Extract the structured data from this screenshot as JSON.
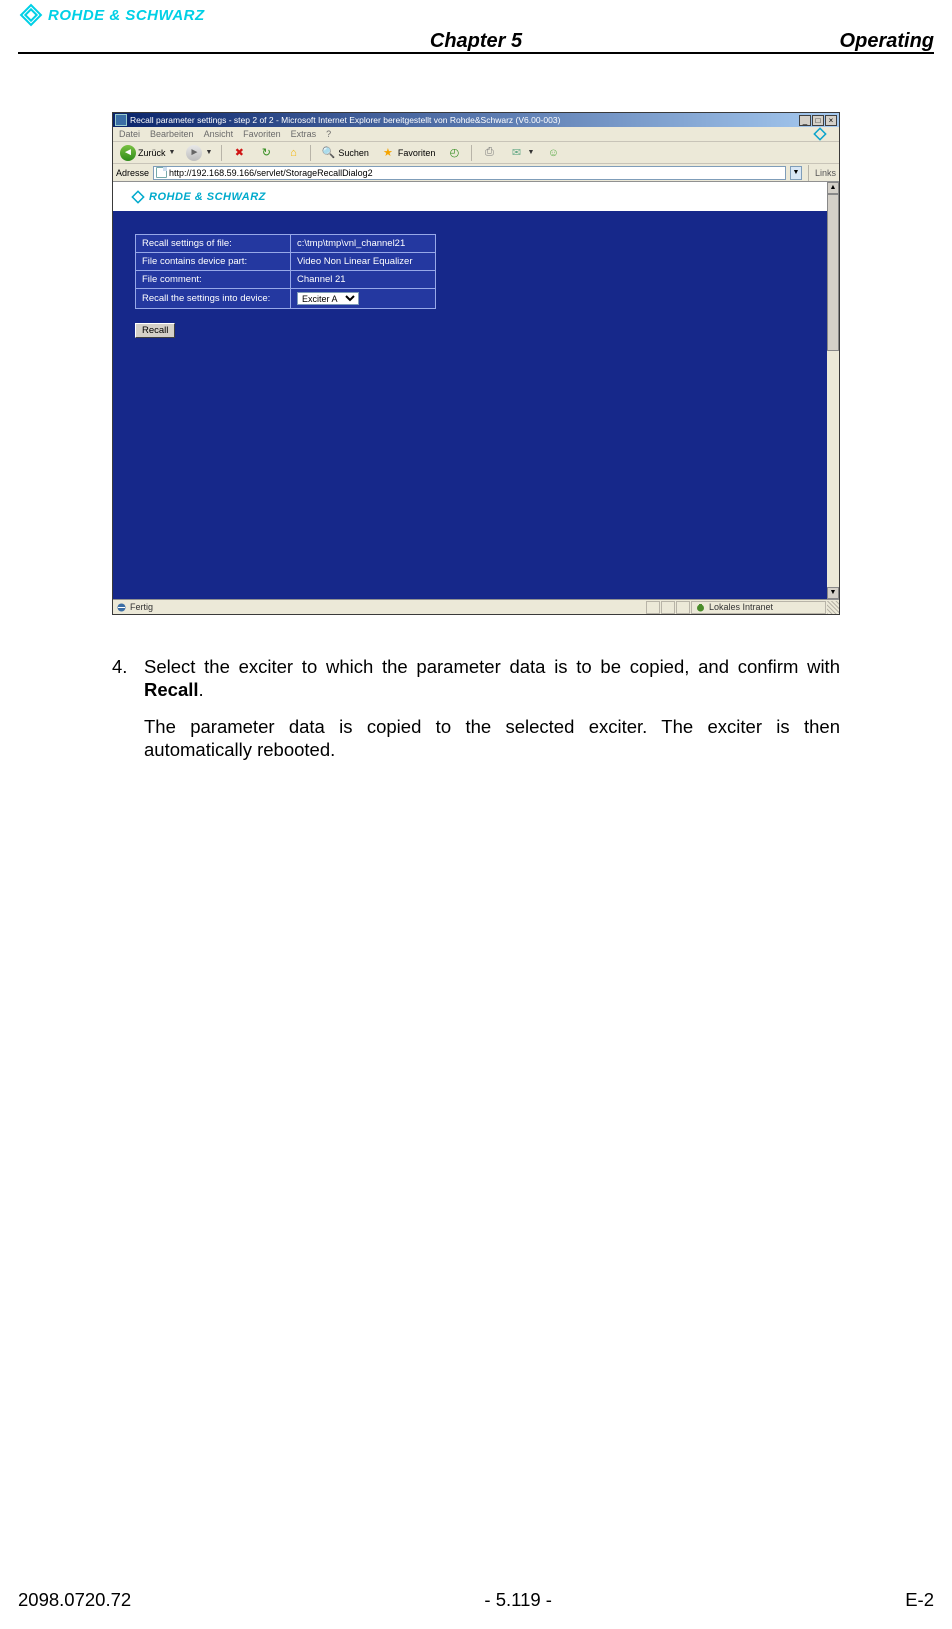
{
  "header": {
    "brand": "ROHDE & SCHWARZ",
    "chapter": "Chapter 5",
    "right": "Operating"
  },
  "screenshot": {
    "titlebar": "Recall parameter settings - step 2 of 2 - Microsoft Internet Explorer bereitgestellt von Rohde&Schwarz (V6.00-003)",
    "win_buttons": {
      "min": "_",
      "max": "□",
      "close": "×"
    },
    "menu": [
      "Datei",
      "Bearbeiten",
      "Ansicht",
      "Favoriten",
      "Extras",
      "?"
    ],
    "toolbar": {
      "back": "Zurück",
      "search": "Suchen",
      "favorites": "Favoriten"
    },
    "addressbar": {
      "label": "Adresse",
      "url": "http://192.168.59.166/servlet/StorageRecallDialog2",
      "links": "Links"
    },
    "banner_brand": "ROHDE & SCHWARZ",
    "form": {
      "rows": [
        {
          "label": "Recall settings of file:",
          "value": "c:\\tmp\\tmp\\vnl_channel21"
        },
        {
          "label": "File contains device part:",
          "value": "Video Non Linear Equalizer"
        },
        {
          "label": "File comment:",
          "value": "Channel 21"
        },
        {
          "label": "Recall the settings into device:",
          "value": "Exciter A"
        }
      ],
      "button": "Recall"
    },
    "statusbar": {
      "done": "Fertig",
      "zone": "Lokales Intranet"
    }
  },
  "body": {
    "step_num": "4.",
    "step_line1_a": "Select the exciter to which the parameter data is to be copied, and confirm with ",
    "step_line1_b": "Recall",
    "step_line1_c": ".",
    "step_line2": "The parameter data is copied to the selected exciter. The exciter is then automatically rebooted."
  },
  "footer": {
    "left": "2098.0720.72",
    "center": "- 5.119 -",
    "right": "E-2"
  }
}
